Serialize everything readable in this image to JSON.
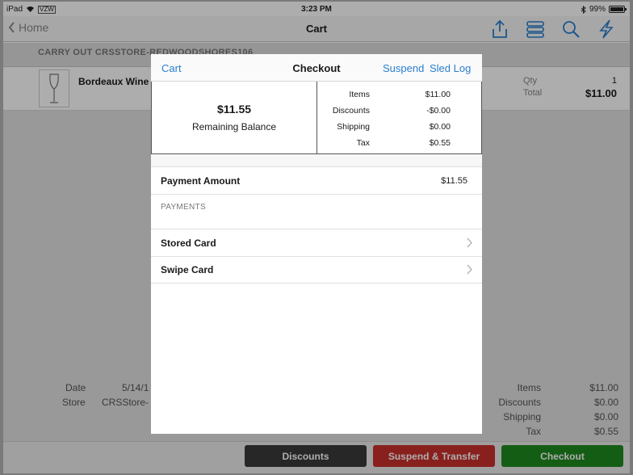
{
  "status_bar": {
    "device": "iPad",
    "carrier": "VZW",
    "time": "3:23 PM",
    "battery": "99%"
  },
  "nav": {
    "back_label": "Home",
    "title": "Cart",
    "icons": [
      "share-icon",
      "list-icon",
      "search-icon",
      "lightning-icon"
    ]
  },
  "store": {
    "label": "CARRY OUT CRSSTORE-REDWOODSHORES106"
  },
  "cart_item": {
    "name": "Bordeaux Wine",
    "qty_label": "Qty",
    "qty": "1",
    "total_label": "Total",
    "total": "$11.00"
  },
  "order_info": {
    "date_label": "Date",
    "date_value": "5/14/1",
    "store_label": "Store",
    "store_value": "CRSStore-",
    "items_label": "Items",
    "items_value": "$11.00",
    "discounts_label": "Discounts",
    "discounts_value": "$0.00",
    "shipping_label": "Shipping",
    "shipping_value": "$0.00",
    "tax_label": "Tax",
    "tax_value": "$0.55"
  },
  "bottom_buttons": {
    "discounts": "Discounts",
    "suspend_transfer": "Suspend & Transfer",
    "checkout": "Checkout"
  },
  "colors": {
    "discounts_btn": "#3a3a3a",
    "suspend_btn": "#c9302c",
    "checkout_btn": "#1e8a1e",
    "link_blue": "#2a7fcf"
  },
  "checkout_modal": {
    "left_link": "Cart",
    "title": "Checkout",
    "suspend_link": "Suspend",
    "sled_log_link": "Sled Log",
    "balance_amount": "$11.55",
    "balance_label": "Remaining Balance",
    "totals": [
      {
        "label": "Items",
        "value": "$11.00"
      },
      {
        "label": "Discounts",
        "value": "-$0.00"
      },
      {
        "label": "Shipping",
        "value": "$0.00"
      },
      {
        "label": "Tax",
        "value": "$0.55"
      }
    ],
    "payment_amount_label": "Payment Amount",
    "payment_amount_value": "$11.55",
    "payments_header": "PAYMENTS",
    "payment_methods": [
      {
        "label": "Stored Card"
      },
      {
        "label": "Swipe Card"
      }
    ]
  }
}
